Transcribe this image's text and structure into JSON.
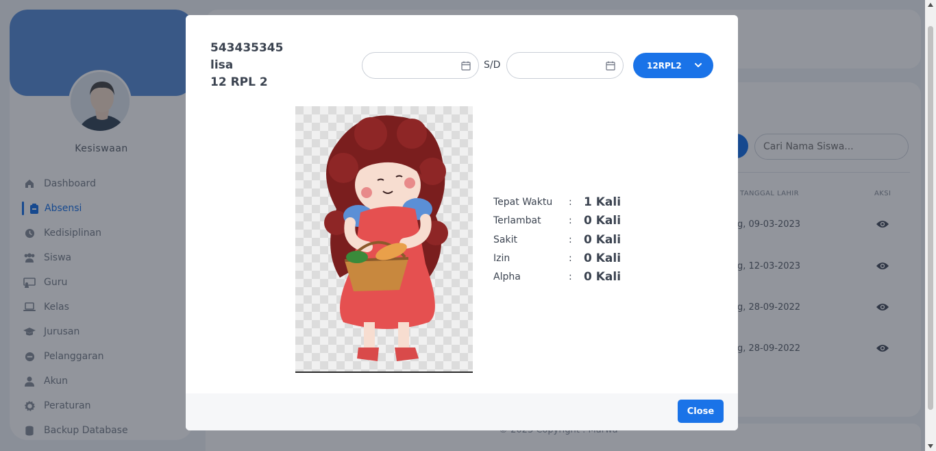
{
  "sidebar": {
    "role": "Kesiswaan",
    "items": [
      {
        "label": "Dashboard",
        "icon": "home-icon"
      },
      {
        "label": "Absensi",
        "icon": "clipboard-icon",
        "active": true
      },
      {
        "label": "Kedisiplinan",
        "icon": "clock-icon"
      },
      {
        "label": "Siswa",
        "icon": "users-icon"
      },
      {
        "label": "Guru",
        "icon": "chalkboard-icon"
      },
      {
        "label": "Kelas",
        "icon": "laptop-icon"
      },
      {
        "label": "Jurusan",
        "icon": "graduation-cap-icon"
      },
      {
        "label": "Pelanggaran",
        "icon": "ban-icon"
      },
      {
        "label": "Akun",
        "icon": "user-icon"
      },
      {
        "label": "Peraturan",
        "icon": "gear-icon"
      },
      {
        "label": "Backup Database",
        "icon": "database-icon"
      }
    ]
  },
  "background": {
    "search_placeholder": "Cari Nama Siswa...",
    "columns": [
      "TANGGAL LAHIR",
      "AKSI"
    ],
    "rows": [
      {
        "birth_date": "g, 09-03-2023"
      },
      {
        "birth_date": "g, 12-03-2023"
      },
      {
        "birth_date": "g, 28-09-2022"
      },
      {
        "birth_date": "g, 28-09-2022"
      }
    ],
    "footer": "© 2023 Copyright : Marwa"
  },
  "modal": {
    "student_id": "543435345",
    "student_name": "lisa",
    "student_class": "12 RPL 2",
    "date_separator": "S/D",
    "class_select": "12RPL2",
    "stats": [
      {
        "label": "Tepat Waktu",
        "colon": ":",
        "value": "1 Kali"
      },
      {
        "label": "Terlambat",
        "colon": ":",
        "value": "0 Kali"
      },
      {
        "label": "Sakit",
        "colon": ":",
        "value": "0 Kali"
      },
      {
        "label": "Izin",
        "colon": ":",
        "value": "0 Kali"
      },
      {
        "label": "Alpha",
        "colon": ":",
        "value": "0 Kali"
      }
    ],
    "close_label": "Close"
  },
  "colors": {
    "accent": "#1a73e8",
    "banner": "#5b8fd6",
    "overlay": "#111928"
  }
}
